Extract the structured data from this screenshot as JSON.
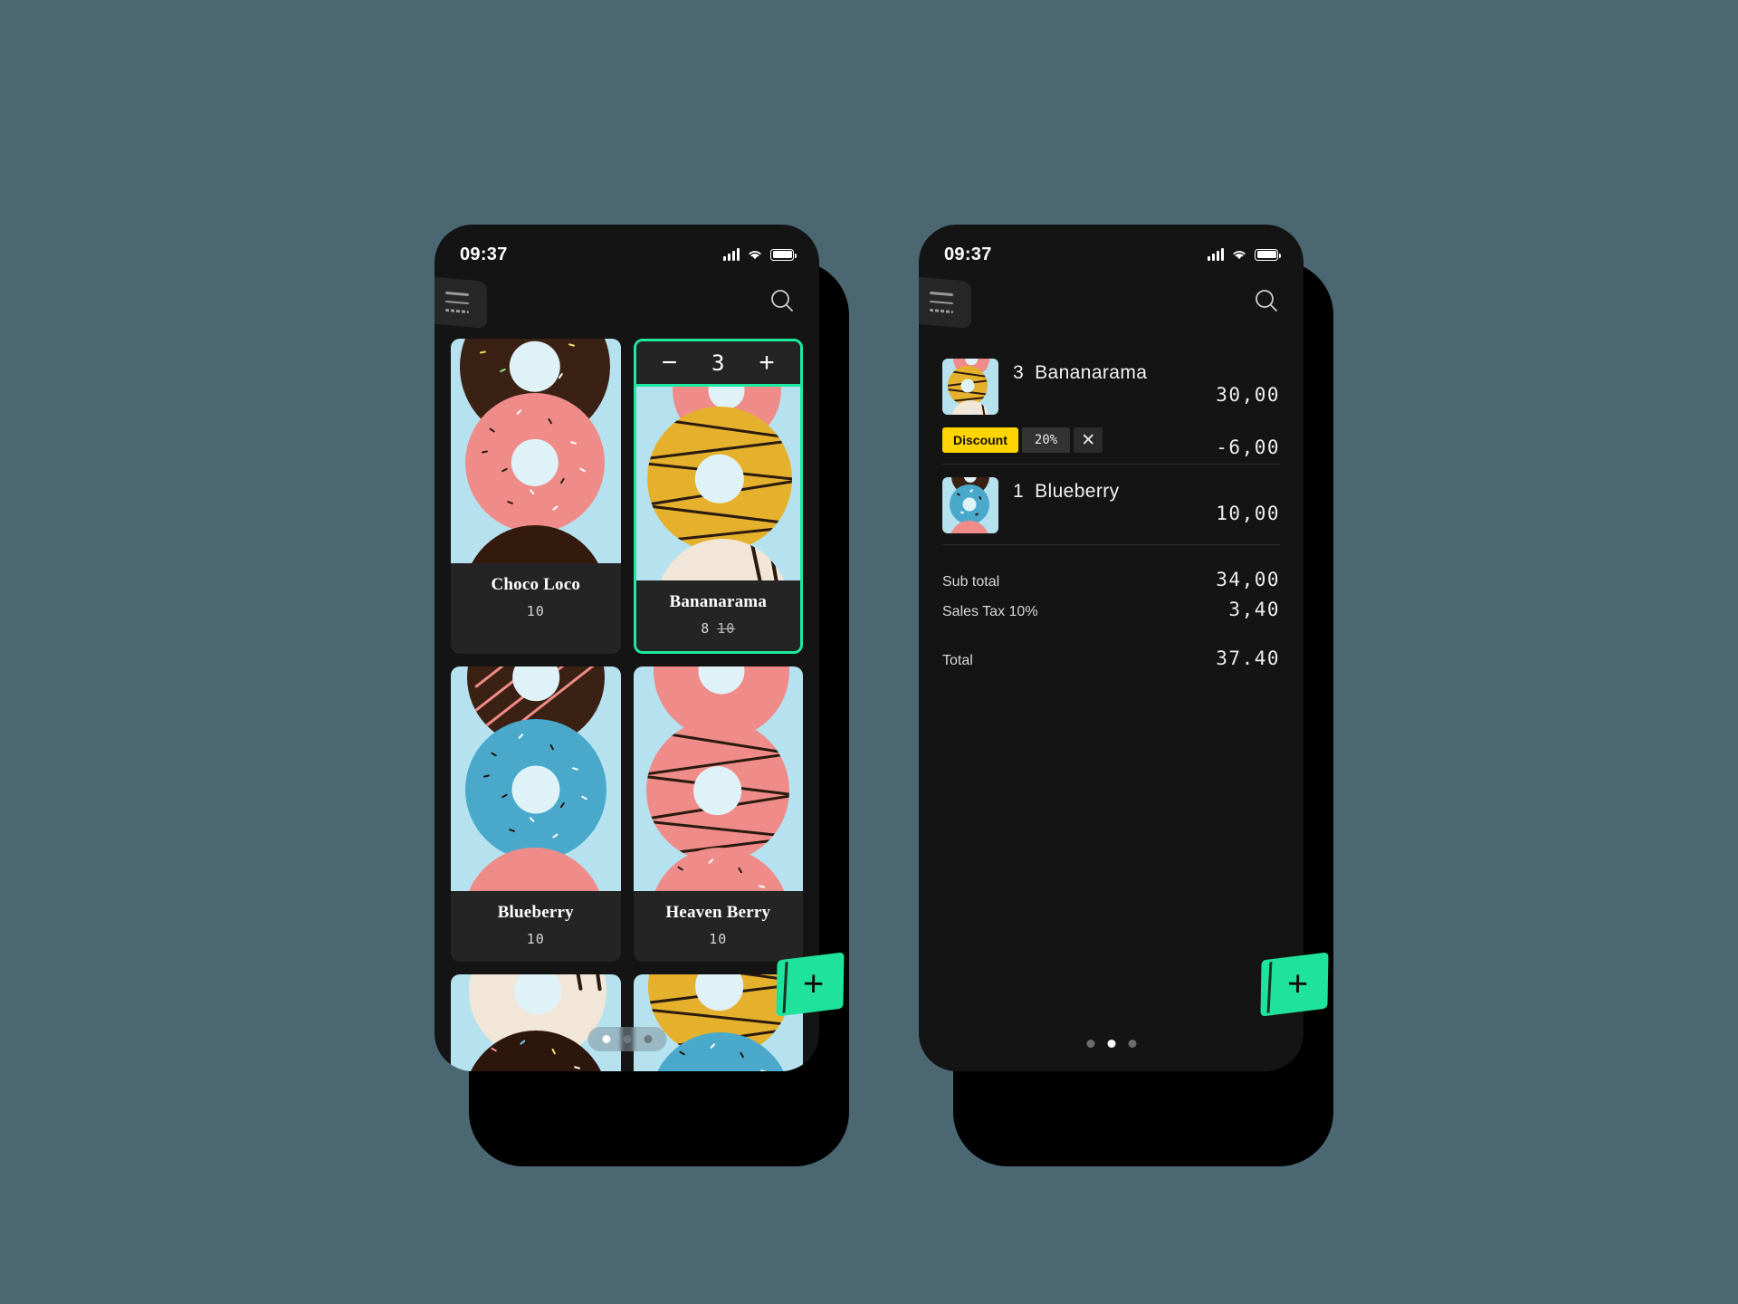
{
  "theme": {
    "background": "#4b6771",
    "screen_bg": "#141414",
    "card_bg": "#242424",
    "accent_green": "#1fe39c",
    "accent_yellow": "#ffd400"
  },
  "phones": {
    "left": {
      "status": {
        "time": "09:37",
        "signal_icon": "signal-bars-icon",
        "wifi_icon": "wifi-icon",
        "battery_icon": "battery-icon"
      },
      "appbar": {
        "menu_icon": "hamburger-menu-icon",
        "search_icon": "search-icon"
      },
      "products": [
        {
          "name": "Choco Loco",
          "price": "10",
          "old_price": "",
          "selected": false,
          "qty": ""
        },
        {
          "name": "Bananarama",
          "price": "8",
          "old_price": "10",
          "selected": true,
          "qty": "3"
        },
        {
          "name": "Blueberry",
          "price": "10",
          "old_price": "",
          "selected": false,
          "qty": ""
        },
        {
          "name": "Heaven Berry",
          "price": "10",
          "old_price": "",
          "selected": false,
          "qty": ""
        }
      ],
      "stepper": {
        "decrement_label": "−",
        "increment_label": "+",
        "value": "3"
      },
      "pager": {
        "dots": 3,
        "active": 0
      },
      "fab": {
        "label": "+",
        "name": "add-item-button"
      }
    },
    "right": {
      "status": {
        "time": "09:37",
        "signal_icon": "signal-bars-icon",
        "wifi_icon": "wifi-icon",
        "battery_icon": "battery-icon"
      },
      "appbar": {
        "menu_icon": "hamburger-menu-icon",
        "search_icon": "search-icon"
      },
      "receipt": {
        "lines": [
          {
            "qty": "3",
            "name": "Bananarama",
            "amount": "30,00",
            "discount": {
              "label": "Discount",
              "percent": "20%",
              "remove_label": "✕",
              "amount": "-6,00"
            }
          },
          {
            "qty": "1",
            "name": "Blueberry",
            "amount": "10,00",
            "discount": null
          }
        ],
        "totals": [
          {
            "label": "Sub total",
            "value": "34,00"
          },
          {
            "label": "Sales Tax 10%",
            "value": "3,40"
          }
        ],
        "grand_total": {
          "label": "Total",
          "value": "37.40"
        }
      },
      "pager": {
        "dots": 3,
        "active": 1
      },
      "fab": {
        "label": "+",
        "name": "add-item-button"
      }
    }
  }
}
